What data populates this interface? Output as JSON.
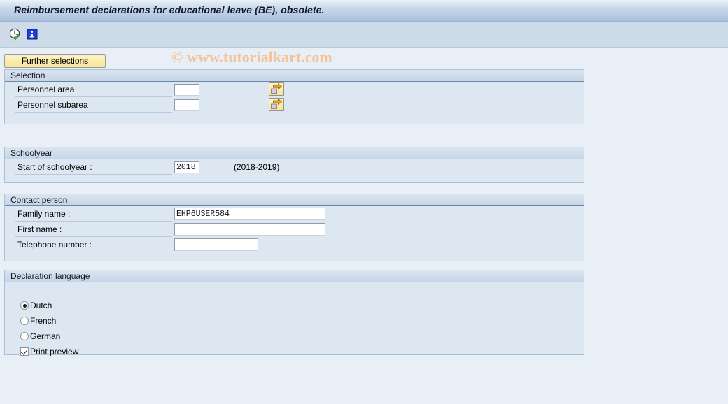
{
  "window": {
    "title": "Reimbursement declarations for educational leave (BE), obsolete.",
    "watermark": "© www.tutorialkart.com"
  },
  "toolbar": {
    "icons": [
      {
        "name": "execute-clock-icon",
        "tooltip": "Execute"
      },
      {
        "name": "information-icon",
        "tooltip": "Information"
      }
    ]
  },
  "buttons": {
    "further_selections": "Further selections"
  },
  "panels": {
    "selection": {
      "header": "Selection",
      "rows": [
        {
          "label": "Personnel area",
          "value": "",
          "arrow": "multiple-selection-arrow"
        },
        {
          "label": "Personnel subarea",
          "value": "",
          "arrow": "multiple-selection-arrow"
        }
      ]
    },
    "schoolyear": {
      "header": "Schoolyear",
      "label": "Start of schoolyear :",
      "value": "2018",
      "range_text": "(2018-2019)"
    },
    "contact_person": {
      "header": "Contact person",
      "rows": [
        {
          "label": "Family name :",
          "value": "EHP6USER584"
        },
        {
          "label": "First name :",
          "value": ""
        },
        {
          "label": "Telephone number :",
          "value": ""
        }
      ]
    },
    "declaration_language": {
      "header": "Declaration language",
      "options": [
        {
          "label": "Dutch",
          "selected": true
        },
        {
          "label": "French",
          "selected": false
        },
        {
          "label": "German",
          "selected": false
        }
      ],
      "print_preview": {
        "label": "Print preview",
        "checked": true
      }
    }
  },
  "colors": {
    "title_bar_top": "#edf3f9",
    "title_bar_bottom": "#a7bdd8",
    "toolbar_bg": "#cddbe9",
    "page_bg": "#e9eff7",
    "panel_bg": "#dde7f1",
    "panel_border": "#a9c0d8",
    "button_yellow": "#fbecab",
    "watermark": "#f3c49a"
  }
}
